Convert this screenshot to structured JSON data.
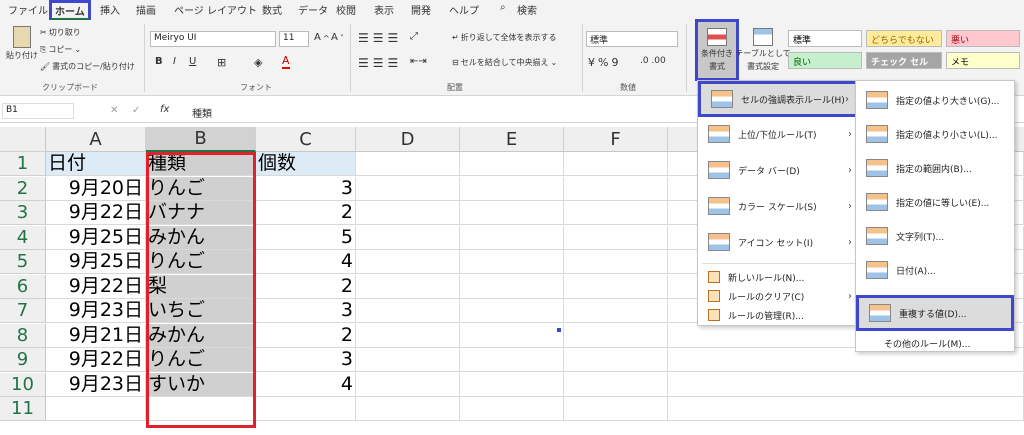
{
  "tabs": [
    "ファイル",
    "ホーム",
    "挿入",
    "描画",
    "ページ レイアウト",
    "数式",
    "データ",
    "校閲",
    "表示",
    "開発",
    "ヘルプ"
  ],
  "search_label": "検索",
  "ribbon": {
    "paste": "貼り付け",
    "cut": "切り取り",
    "copy": "コピー",
    "format_painter": "書式のコピー/貼り付け",
    "clipboard_group": "クリップボード",
    "font_name": "Meiryo UI",
    "font_size": "11",
    "font_group": "フォント",
    "wrap_text": "折り返して全体を表示する",
    "merge_center": "セルを結合して中央揃え",
    "alignment_group": "配置",
    "number_format": "標準",
    "number_group": "数値",
    "cond_format_line1": "条件付き",
    "cond_format_line2": "書式",
    "table_format_line1": "テーブルとして",
    "table_format_line2": "書式設定",
    "styles": [
      {
        "label": "標準",
        "bg": "#ffffff",
        "fg": "#000000"
      },
      {
        "label": "どちらでもない",
        "bg": "#ffeb9c",
        "fg": "#9c6500"
      },
      {
        "label": "悪い",
        "bg": "#ffc7ce",
        "fg": "#9c0006"
      },
      {
        "label": "良い",
        "bg": "#c6efce",
        "fg": "#006100"
      },
      {
        "label": "チェック セル",
        "bg": "#a5a5a5",
        "fg": "#ffffff"
      },
      {
        "label": "メモ",
        "bg": "#ffffcc",
        "fg": "#000000"
      }
    ]
  },
  "formula": {
    "namebox": "B1",
    "content": "種類",
    "fx": "fx"
  },
  "columns": [
    "A",
    "B",
    "C",
    "D",
    "E",
    "F"
  ],
  "rows": [
    "1",
    "2",
    "3",
    "4",
    "5",
    "6",
    "7",
    "8",
    "9",
    "10",
    "11"
  ],
  "table": [
    [
      "日付",
      "種類",
      "個数"
    ],
    [
      "9月20日",
      "りんご",
      "3"
    ],
    [
      "9月22日",
      "バナナ",
      "2"
    ],
    [
      "9月25日",
      "みかん",
      "5"
    ],
    [
      "9月25日",
      "りんご",
      "4"
    ],
    [
      "9月22日",
      "梨",
      "2"
    ],
    [
      "9月23日",
      "いちご",
      "3"
    ],
    [
      "9月21日",
      "みかん",
      "2"
    ],
    [
      "9月22日",
      "りんご",
      "3"
    ],
    [
      "9月23日",
      "すいか",
      "4"
    ]
  ],
  "menu": {
    "items": [
      "セルの強調表示ルール(H)",
      "上位/下位ルール(T)",
      "データ バー(D)",
      "カラー スケール(S)",
      "アイコン セット(I)"
    ],
    "small_items": [
      "新しいルール(N)...",
      "ルールのクリア(C)",
      "ルールの管理(R)..."
    ]
  },
  "submenu": {
    "items": [
      "指定の値より大きい(G)...",
      "指定の値より小さい(L)...",
      "指定の範囲内(B)...",
      "指定の値に等しい(E)...",
      "文字列(T)...",
      "日付(A)...",
      "重複する値(D)..."
    ],
    "other": "その他のルール(M)..."
  },
  "colors": {
    "accent_blue": "#3f48cc",
    "selection_red": "#e0202a",
    "excel_green": "#217346"
  }
}
